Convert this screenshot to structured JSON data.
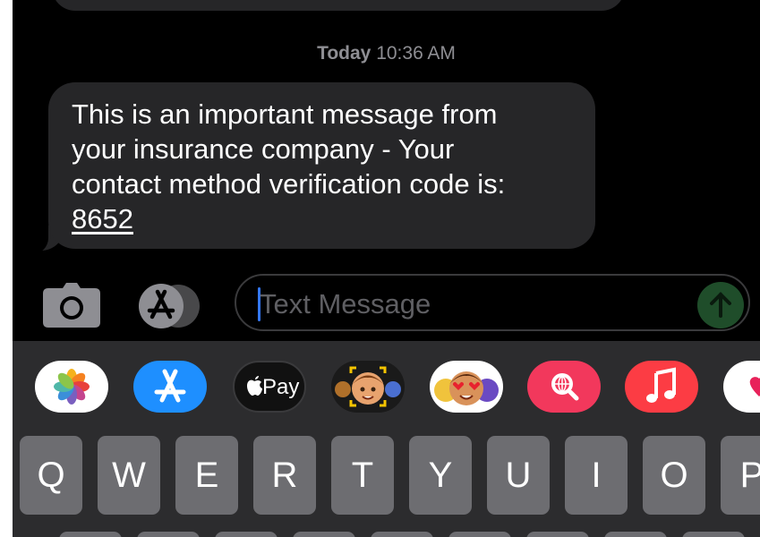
{
  "conversation": {
    "timestamp_day": "Today",
    "timestamp_time": "10:36 AM",
    "message": {
      "lines": [
        "This is an important message from",
        "your insurance company - Your",
        "contact method verification code is:"
      ],
      "code": "8652"
    }
  },
  "input": {
    "placeholder": "Text Message"
  },
  "app_strip": {
    "apple_pay_label": "Pay",
    "icons": [
      "photos-icon",
      "app-store-icon",
      "apple-pay-icon",
      "memoji-icon",
      "animoji-icon",
      "web-search-icon",
      "music-icon",
      "digital-touch-icon"
    ]
  },
  "keyboard": {
    "row1": [
      "Q",
      "W",
      "E",
      "R",
      "T",
      "Y",
      "U",
      "I",
      "O",
      "P"
    ]
  },
  "colors": {
    "background": "#000000",
    "bubble": "#262628",
    "key": "#6d6d71",
    "keyboard_bg": "#2c2c2e",
    "cursor": "#3478f6",
    "send_button": "#1f4d2a",
    "app_store_blue": "#1e8fff",
    "web_search_pink": "#f2385c",
    "music_red": "#fc3c44"
  }
}
